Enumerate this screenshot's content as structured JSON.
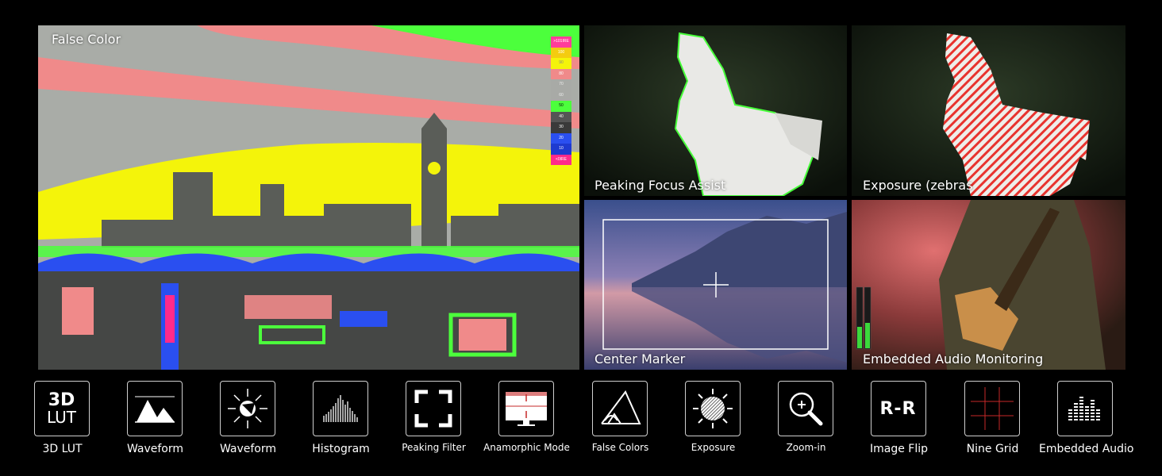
{
  "panels": {
    "false_color": {
      "label": "False Color"
    },
    "peaking": {
      "label": "Peaking Focus Assist"
    },
    "exposure": {
      "label": "Exposure (zebras"
    },
    "center_marker": {
      "label": "Center Marker"
    },
    "audio": {
      "label": "Embedded Audio Monitoring"
    }
  },
  "false_color_scale": [
    ">101IRE",
    "100",
    "90",
    "80",
    "70",
    "60",
    "50",
    "40",
    "30",
    "20",
    "10",
    "<0IRE"
  ],
  "features": [
    {
      "label": "3D LUT",
      "icon": "3d-lut-icon",
      "icon_text_1": "3D",
      "icon_text_2": "LUT"
    },
    {
      "label": "Waveform",
      "icon": "waveform-icon"
    },
    {
      "label": "Waveform",
      "icon": "vectorscope-icon"
    },
    {
      "label": "Histogram",
      "icon": "histogram-icon"
    },
    {
      "label": "Peaking Filter",
      "icon": "peaking-filter-icon"
    },
    {
      "label": "Anamorphic Mode",
      "icon": "anamorphic-mode-icon"
    },
    {
      "label": "False Colors",
      "icon": "false-colors-icon"
    },
    {
      "label": "Exposure",
      "icon": "exposure-icon"
    },
    {
      "label": "Zoom-in",
      "icon": "zoom-in-icon"
    },
    {
      "label": "Image Flip",
      "icon": "image-flip-icon",
      "icon_text": "R-R"
    },
    {
      "label": "Nine Grid",
      "icon": "nine-grid-icon"
    },
    {
      "label": "Embedded Audio",
      "icon": "embedded-audio-icon"
    }
  ],
  "colors": {
    "false_yellow": "#f4f40a",
    "false_pink": "#f08a8a",
    "false_green": "#4cff3c",
    "false_blue": "#2a4ff0",
    "false_grey": "#a8aaa6",
    "zebra_red": "#e8332e",
    "grid_red": "#c62828"
  }
}
